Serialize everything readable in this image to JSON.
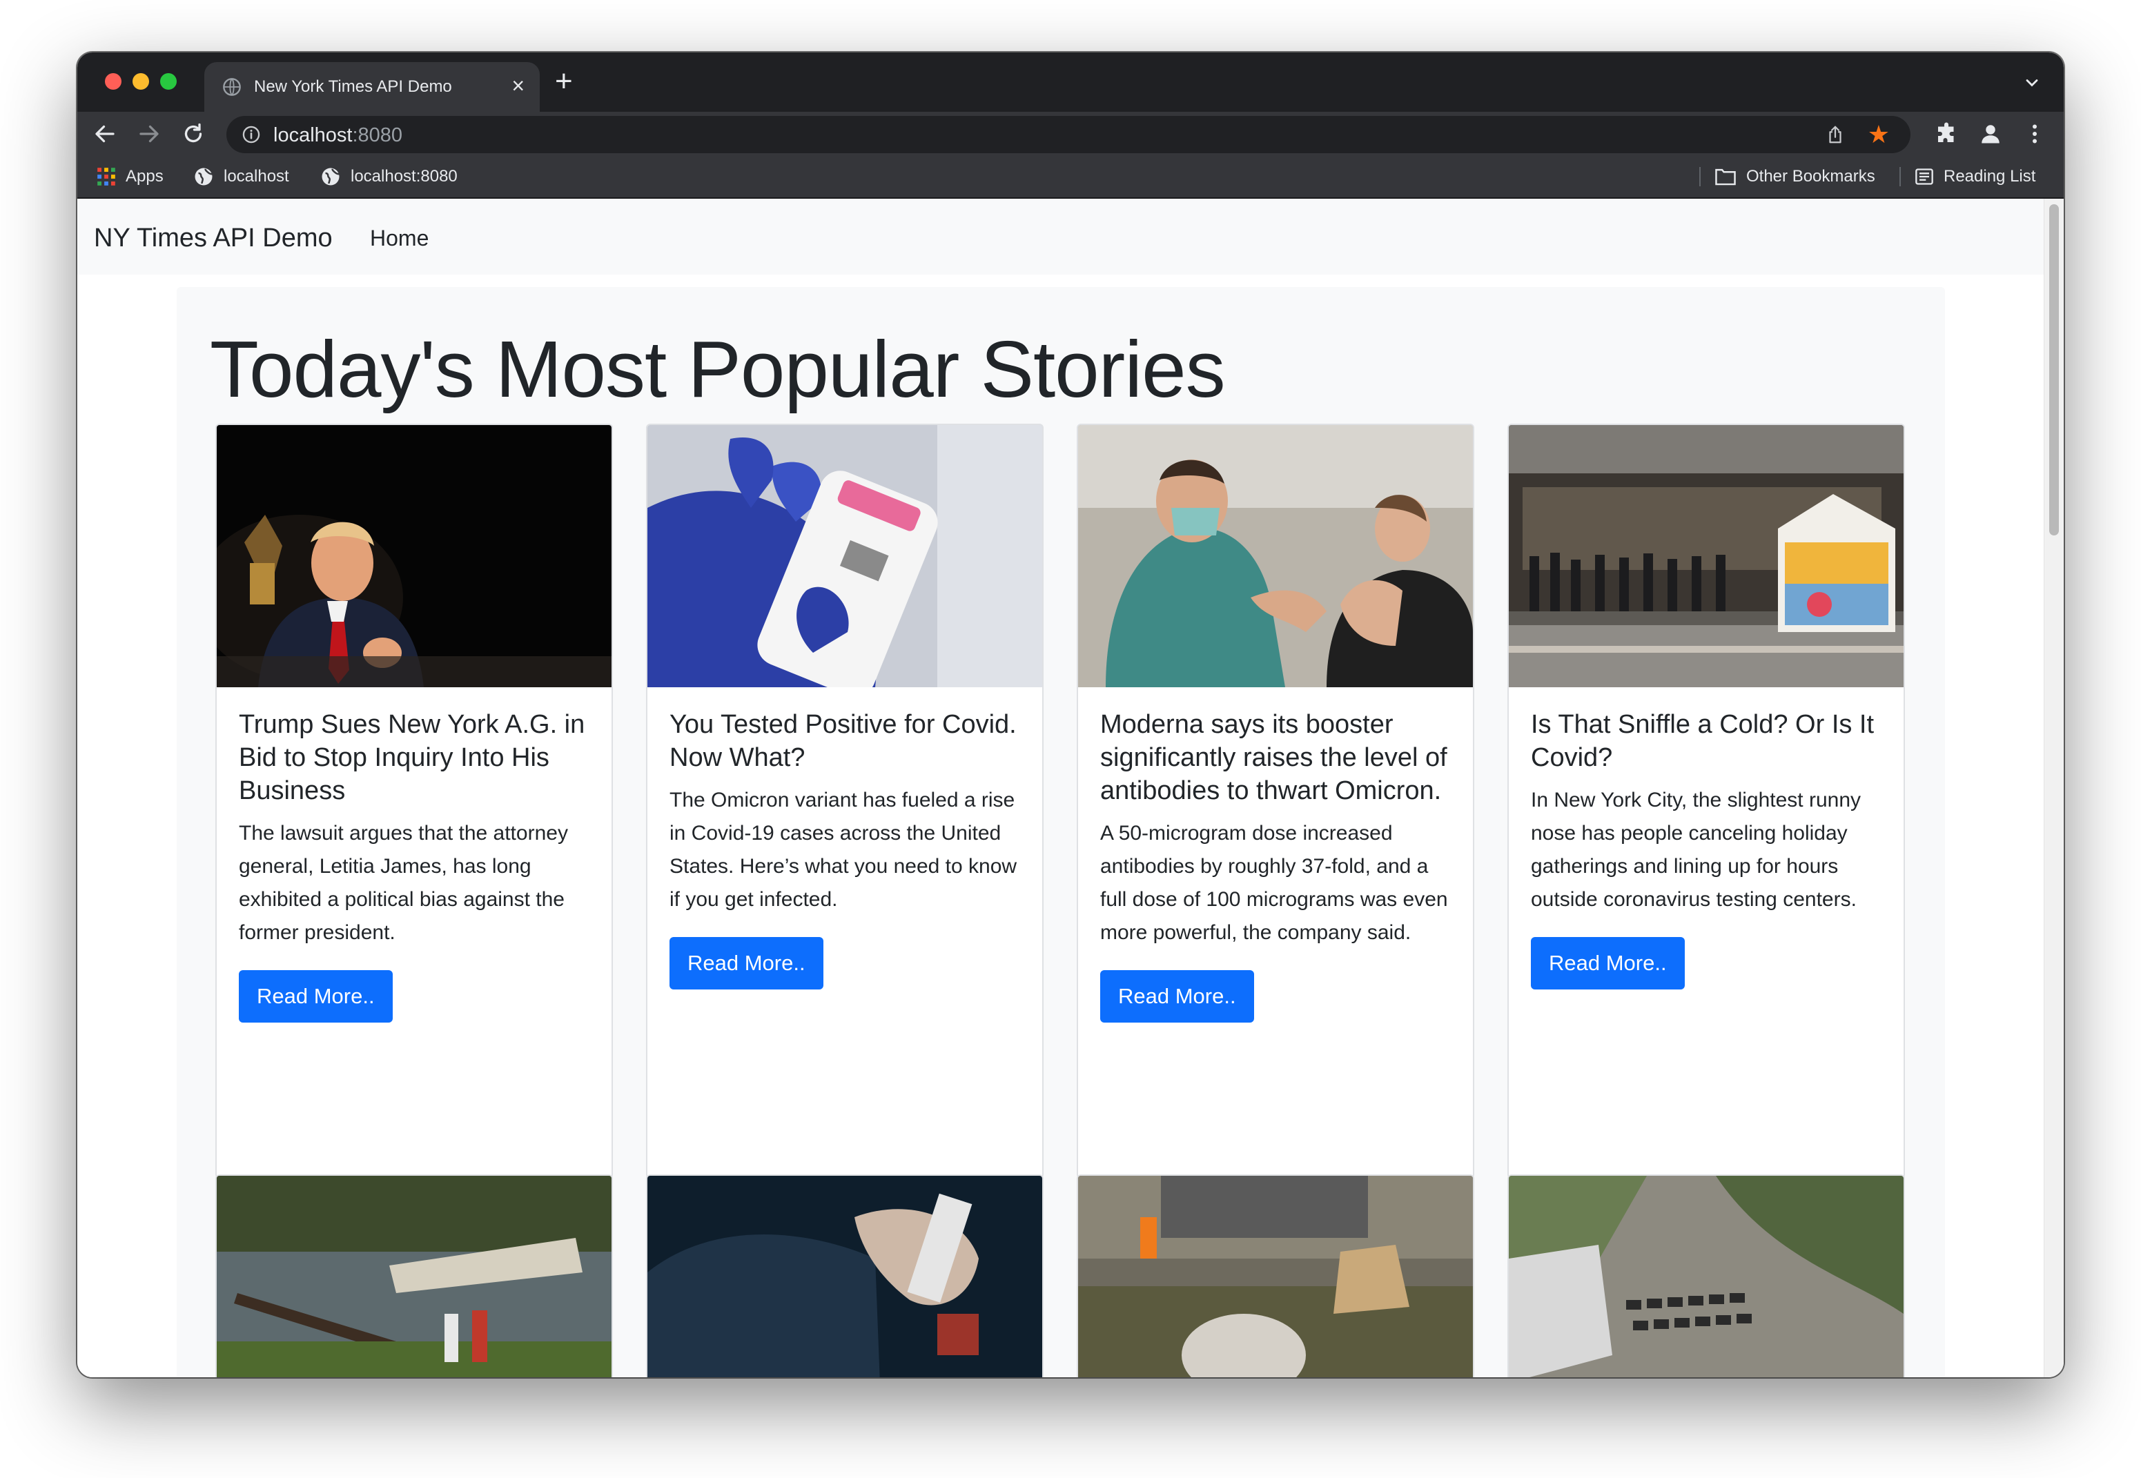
{
  "browser": {
    "tab_title": "New York Times API Demo",
    "tab_close": "×",
    "new_tab": "+",
    "url_host": "localhost",
    "url_port": ":8080",
    "star": "★",
    "bookmarks": {
      "apps": "Apps",
      "b1": "localhost",
      "b2": "localhost:8080",
      "other": "Other Bookmarks",
      "reading": "Reading List"
    }
  },
  "navbar": {
    "brand": "NY Times API Demo",
    "home": "Home"
  },
  "page": {
    "heading": "Today's Most Popular Stories",
    "read_more_label": "Read More.."
  },
  "stories": [
    {
      "title": "Trump Sues New York A.G. in Bid to Stop Inquiry Into His Business",
      "abstract": "The lawsuit argues that the attorney general, Letitia James, has long exhibited a political bias against the former president."
    },
    {
      "title": "You Tested Positive for Covid. Now What?",
      "abstract": "The Omicron variant has fueled a rise in Covid-19 cases across the United States. Here’s what you need to know if you get infected."
    },
    {
      "title": "Moderna says its booster significantly raises the level of antibodies to thwart Omicron.",
      "abstract": "A 50-microgram dose increased antibodies by roughly 37-fold, and a full dose of 100 micrograms was even more powerful, the company said."
    },
    {
      "title": "Is That Sniffle a Cold? Or Is It Covid?",
      "abstract": "In New York City, the slightest runny nose has people canceling holiday gatherings and lining up for hours outside coronavirus testing centers."
    }
  ],
  "colors": {
    "primary_button": "#0d6efd",
    "navbar_bg": "#f8f9fa",
    "browser_chrome": "#35363a",
    "bookmark_star": "#f97316"
  }
}
